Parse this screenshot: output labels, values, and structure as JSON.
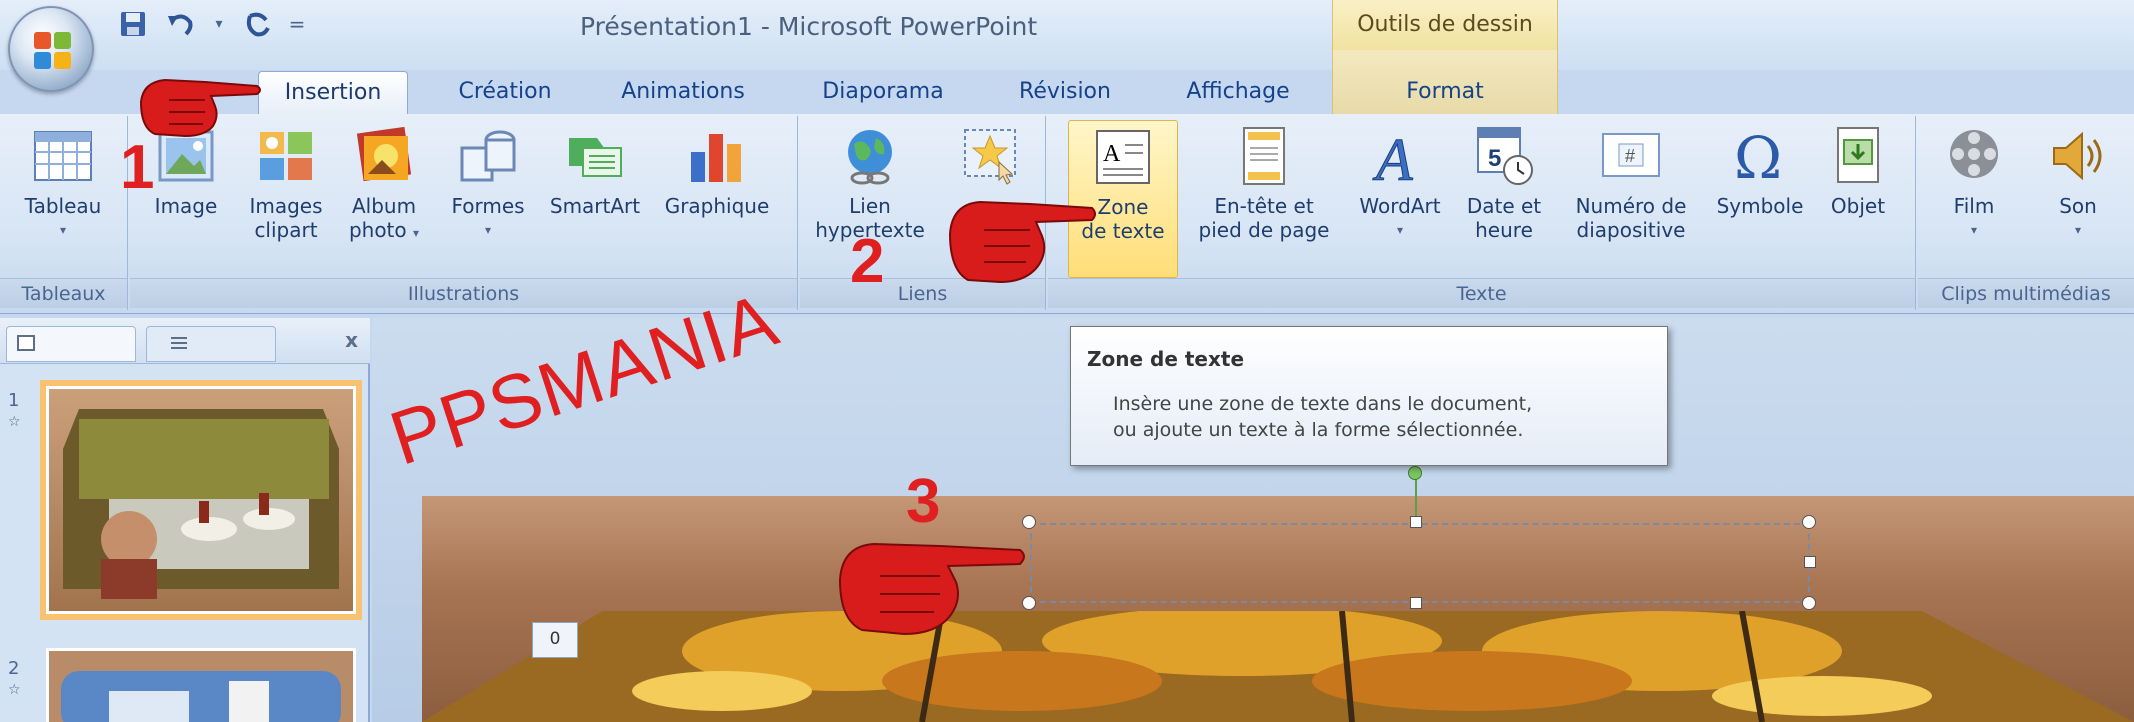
{
  "titlebar": {
    "doc_title": "Présentation1 - Microsoft PowerPoint",
    "context_tab_group": "Outils de dessin"
  },
  "quick_access": [
    "save-icon",
    "undo-icon",
    "redo-icon",
    "customize-icon"
  ],
  "tabs": [
    {
      "label": "Insertion",
      "active": true
    },
    {
      "label": "Création"
    },
    {
      "label": "Animations"
    },
    {
      "label": "Diaporama"
    },
    {
      "label": "Révision"
    },
    {
      "label": "Affichage"
    },
    {
      "label": "Format",
      "contextual": true
    }
  ],
  "ribbon": {
    "groups": {
      "tableaux": "Tableaux",
      "illustrations": "Illustrations",
      "liens": "Liens",
      "texte": "Texte",
      "clips": "Clips multimédias"
    },
    "buttons": {
      "tableau": "Tableau",
      "image": "Image",
      "images_clipart_1": "Images",
      "images_clipart_2": "clipart",
      "album_1": "Album",
      "album_2": "photo",
      "formes": "Formes",
      "smartart": "SmartArt",
      "graphique": "Graphique",
      "lien_1": "Lien",
      "lien_2": "hypertexte",
      "zone_1": "Zone",
      "zone_2": "de texte",
      "entete_1": "En-tête et",
      "entete_2": "pied de page",
      "wordart": "WordArt",
      "date_1": "Date et",
      "date_2": "heure",
      "numero_1": "Numéro de",
      "numero_2": "diapositive",
      "symbole": "Symbole",
      "objet": "Objet",
      "film": "Film",
      "son": "Son"
    }
  },
  "tooltip": {
    "title": "Zone de texte",
    "line1": "Insère une zone de texte dans le document,",
    "line2": "ou ajoute un texte à la forme sélectionnée."
  },
  "slides_panel": {
    "slide1": "1",
    "slide2": "2",
    "close": "x"
  },
  "canvas": {
    "page_counter": "0"
  },
  "annotations": {
    "watermark": "PPSMANIA",
    "step1": "1",
    "step2": "2",
    "step3": "3"
  },
  "colors": {
    "ribbon_bg": "#d9e6f5",
    "tab_text": "#15428b",
    "annotation_red": "#e02020",
    "highlight": "#ffde78"
  }
}
